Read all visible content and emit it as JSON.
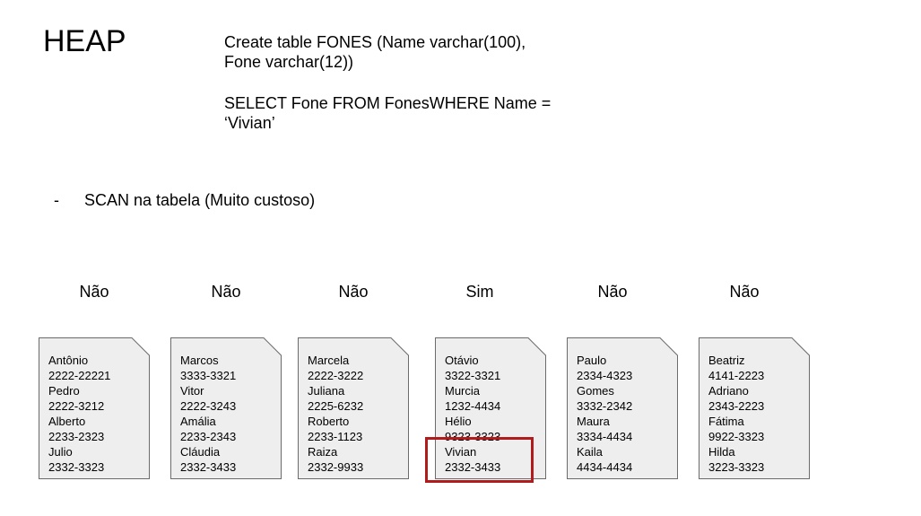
{
  "title": "HEAP",
  "sql": {
    "create_line1": "Create table FONES (Name varchar(100),",
    "create_line2": "Fone varchar(12))",
    "select_line1": "SELECT Fone FROM FonesWHERE Name =",
    "select_line2": "‘Vivian’"
  },
  "bullet": {
    "marker": "-",
    "text": "SCAN na tabela (Muito custoso)"
  },
  "pages": [
    {
      "label": "Não",
      "lines": [
        "Antônio",
        "2222-22221",
        "Pedro",
        "2222-3212",
        "Alberto",
        "2233-2323",
        "Julio",
        "2332-3323"
      ]
    },
    {
      "label": "Não",
      "lines": [
        "Marcos",
        "3333-3321",
        "Vitor",
        "2222-3243",
        "Amália",
        "2233-2343",
        "Cláudia",
        "2332-3433"
      ]
    },
    {
      "label": "Não",
      "lines": [
        "Marcela",
        "2222-3222",
        "Juliana",
        "2225-6232",
        "Roberto",
        "2233-1123",
        "Raiza",
        "2332-9933"
      ]
    },
    {
      "label": "Sim",
      "lines": [
        "Otávio",
        "3322-3321",
        "Murcia",
        "1232-4434",
        "Hélio",
        "9323-3323",
        "Vivian",
        "2332-3433"
      ]
    },
    {
      "label": "Não",
      "lines": [
        "Paulo",
        "2334-4323",
        "Gomes",
        "3332-2342",
        "Maura",
        "3334-4434",
        "Kaila",
        "4434-4434"
      ]
    },
    {
      "label": "Não",
      "lines": [
        "Beatriz",
        "4141-2223",
        "Adriano",
        "2343-2223",
        "Fátima",
        "9922-3323",
        "Hilda",
        "3223-3323"
      ]
    }
  ],
  "colors": {
    "page_fill": "#eeeeee",
    "page_stroke": "#6b6b6b",
    "highlight": "#b21b1b"
  }
}
